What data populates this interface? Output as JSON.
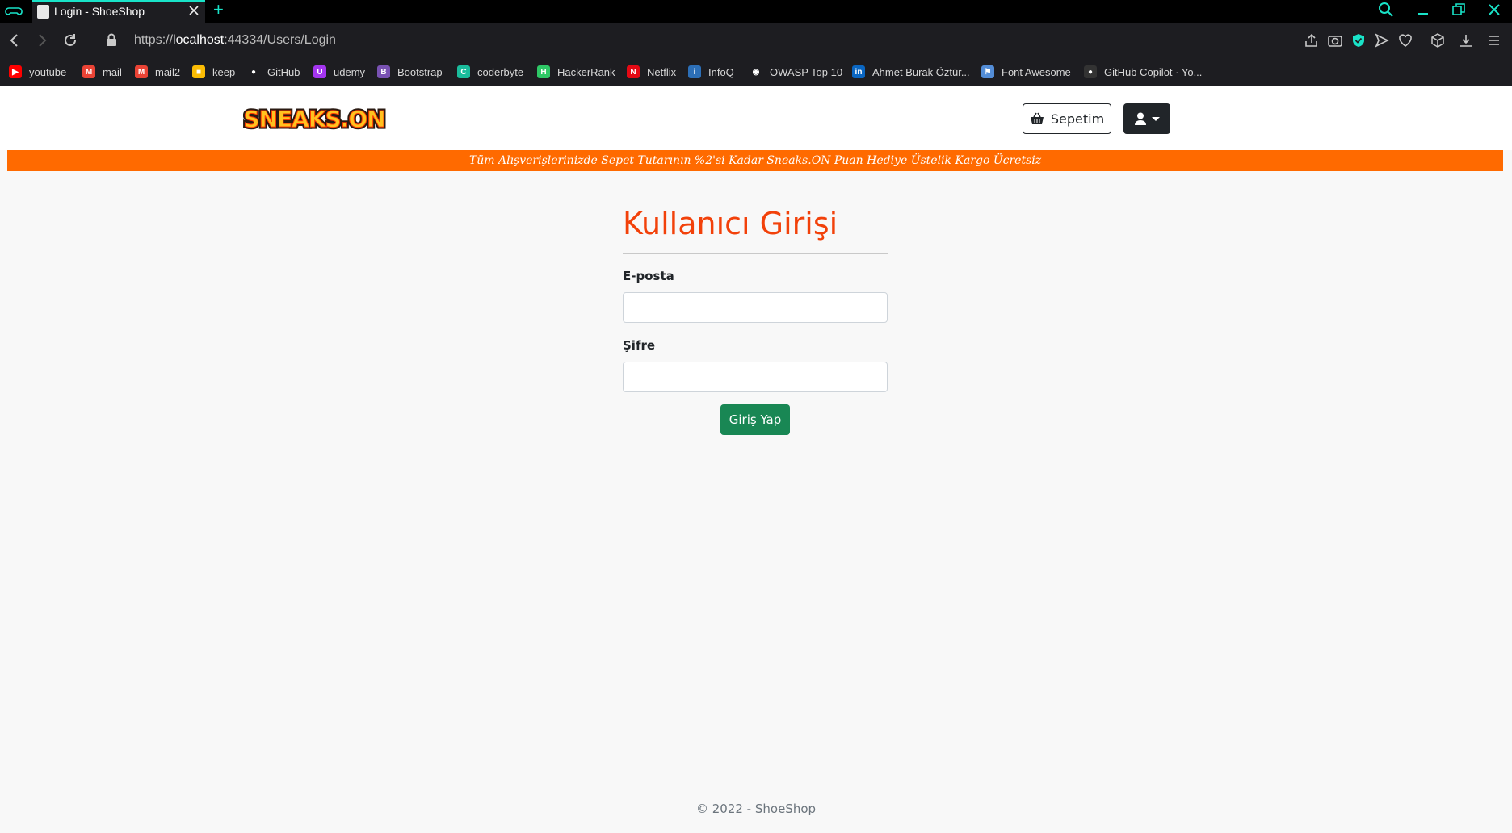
{
  "browser": {
    "tab_title": "Login - ShoeShop",
    "url_prefix": "https://",
    "url_host": "localhost",
    "url_rest": ":44334/Users/Login",
    "bookmarks": [
      {
        "label": "youtube",
        "icon": "youtube-icon",
        "color": "#ff0000",
        "glyph": "▶"
      },
      {
        "label": "mail",
        "icon": "gmail-icon",
        "color": "#ea4335",
        "glyph": "M"
      },
      {
        "label": "mail2",
        "icon": "gmail-icon",
        "color": "#ea4335",
        "glyph": "M"
      },
      {
        "label": "keep",
        "icon": "keep-icon",
        "color": "#fbbc04",
        "glyph": "■"
      },
      {
        "label": "GitHub",
        "icon": "github-icon",
        "color": "#ffffff",
        "glyph": "●"
      },
      {
        "label": "udemy",
        "icon": "udemy-icon",
        "color": "#a435f0",
        "glyph": "U"
      },
      {
        "label": "Bootstrap",
        "icon": "bootstrap-icon",
        "color": "#7952b3",
        "glyph": "B"
      },
      {
        "label": "coderbyte",
        "icon": "coderbyte-icon",
        "color": "#1abc9c",
        "glyph": "C"
      },
      {
        "label": "HackerRank",
        "icon": "hackerrank-icon",
        "color": "#2ec866",
        "glyph": "H"
      },
      {
        "label": "Netflix",
        "icon": "netflix-icon",
        "color": "#e50914",
        "glyph": "N"
      },
      {
        "label": "InfoQ",
        "icon": "infoq-icon",
        "color": "#2c6fb7",
        "glyph": "i"
      },
      {
        "label": "OWASP Top 10",
        "icon": "owasp-icon",
        "color": "#ffffff",
        "glyph": "◉"
      },
      {
        "label": "Ahmet Burak Öztür...",
        "icon": "linkedin-icon",
        "color": "#0a66c2",
        "glyph": "in"
      },
      {
        "label": "Font Awesome",
        "icon": "font-awesome-icon",
        "color": "#538dd7",
        "glyph": "⚑"
      },
      {
        "label": "GitHub Copilot · Yo...",
        "icon": "github-copilot-icon",
        "color": "#333333",
        "glyph": "●"
      }
    ]
  },
  "header": {
    "logo_text": "SNEAKS.ON",
    "cart_label": "Sepetim"
  },
  "promo": {
    "text": "Tüm Alışverişlerinizde Sepet Tutarının %2'si Kadar Sneaks.ON Puan Hediye Üstelik Kargo Ücretsiz"
  },
  "login": {
    "title": "Kullanıcı Girişi",
    "email_label": "E-posta",
    "email_value": "",
    "password_label": "Şifre",
    "password_value": "",
    "submit_label": "Giriş Yap"
  },
  "footer": {
    "text": "© 2022 - ShoeShop"
  },
  "colors": {
    "accent": "#19e3c8",
    "promo_bg": "#ff6a00",
    "title": "#f2410a",
    "submit": "#198754"
  }
}
